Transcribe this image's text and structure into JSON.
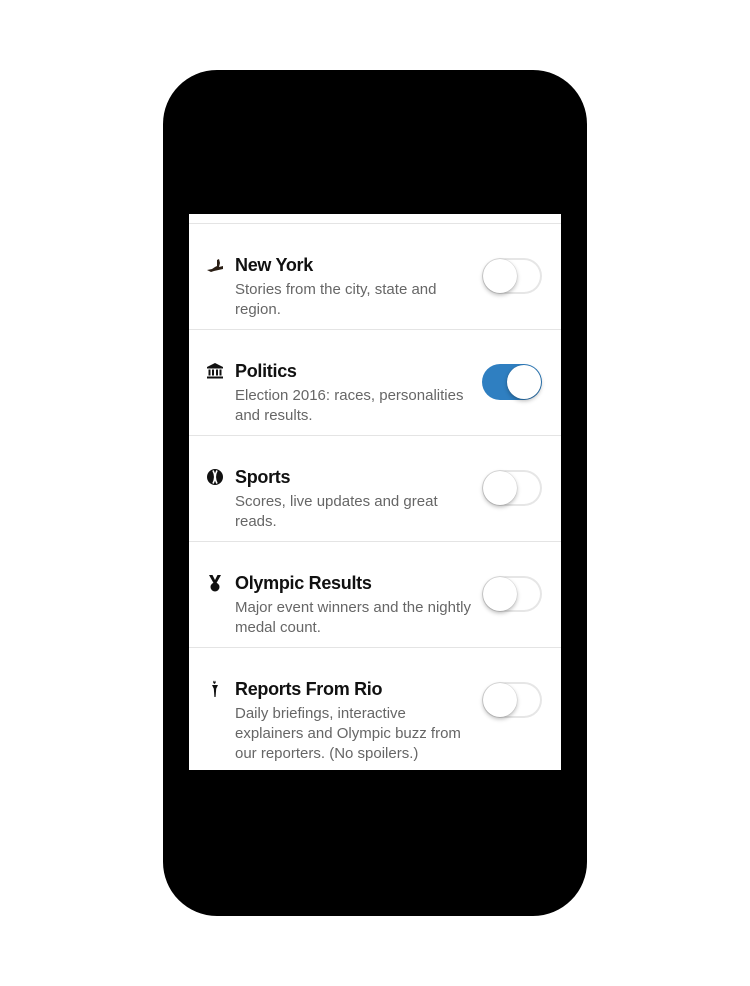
{
  "settings": {
    "items": [
      {
        "title": "New York",
        "description": "Stories from the city, state and region.",
        "icon": "new-york-state-icon",
        "enabled": false
      },
      {
        "title": "Politics",
        "description": "Election 2016: races, personalities and results.",
        "icon": "capitol-building-icon",
        "enabled": true
      },
      {
        "title": "Sports",
        "description": "Scores, live updates and great reads.",
        "icon": "baseball-icon",
        "enabled": false
      },
      {
        "title": "Olympic Results",
        "description": "Major event winners and the nightly medal count.",
        "icon": "medal-icon",
        "enabled": false
      },
      {
        "title": "Reports From Rio",
        "description": "Daily briefings, interactive explainers and Olympic buzz from our reporters. (No spoilers.)",
        "icon": "olympic-torch-icon",
        "enabled": false
      }
    ]
  },
  "colors": {
    "toggle_on": "#2f7fc1",
    "toggle_off_border": "#e6e6e6",
    "title": "#111111",
    "description": "#666666",
    "divider": "#e4e4e4",
    "device": "#000000"
  }
}
